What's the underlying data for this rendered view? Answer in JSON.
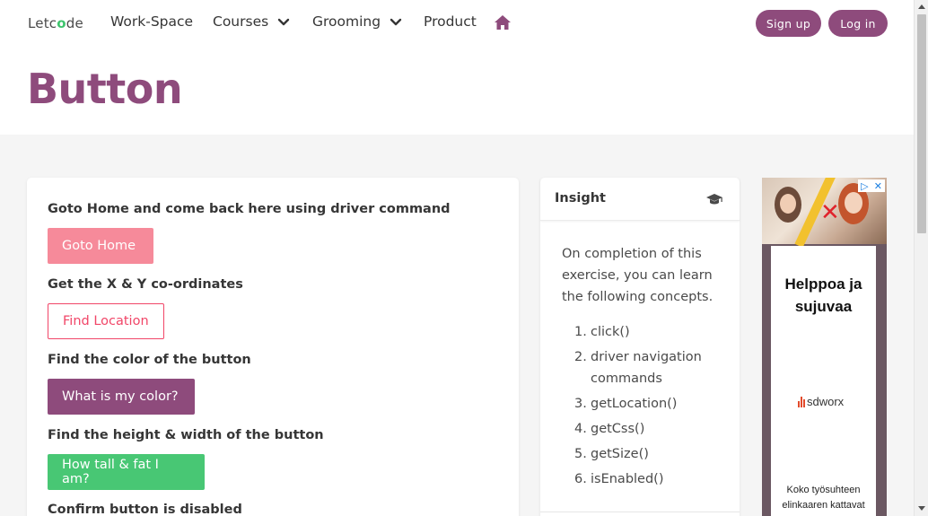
{
  "nav": {
    "logo_prefix": "Letc",
    "logo_o": "o",
    "logo_suffix": "de",
    "items": [
      {
        "label": "Work-Space"
      },
      {
        "label": "Courses"
      },
      {
        "label": "Grooming"
      },
      {
        "label": "Product"
      }
    ],
    "signup_label": "Sign up",
    "login_label": "Log in"
  },
  "page": {
    "title": "Button"
  },
  "exercises": [
    {
      "question": "Goto Home and come back here using driver command",
      "button": "Goto Home"
    },
    {
      "question": "Get the X & Y co-ordinates",
      "button": "Find Location"
    },
    {
      "question": "Find the color of the button",
      "button": "What is my color?"
    },
    {
      "question": "Find the height & width of the button",
      "button": "How tall & fat I am?"
    },
    {
      "question": "Confirm button is disabled"
    }
  ],
  "insight": {
    "title": "Insight",
    "intro": "On completion of this exercise, you can learn the following concepts.",
    "concepts": [
      {
        "n": "1.",
        "text": "click()"
      },
      {
        "n": "2.",
        "text": "driver navigation commands"
      },
      {
        "n": "3.",
        "text": "getLocation()"
      },
      {
        "n": "4.",
        "text": "getCss()"
      },
      {
        "n": "5.",
        "text": "getSize()"
      },
      {
        "n": "6.",
        "text": "isEnabled()"
      }
    ]
  },
  "ad": {
    "headline": "Helppoa ja sujuvaa",
    "brand": "sdworx",
    "footer": "Koko työsuhteen elinkaaren kattavat"
  },
  "colors": {
    "brand": "#8e4b7c",
    "danger": "#f14668",
    "success": "#48c774"
  }
}
